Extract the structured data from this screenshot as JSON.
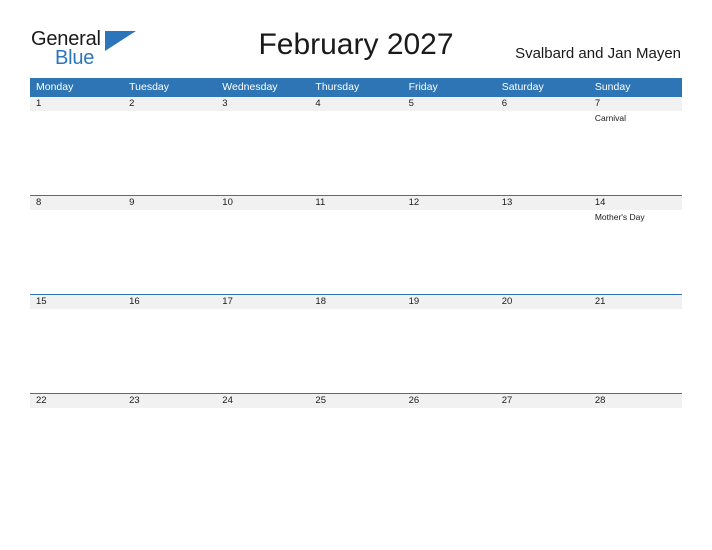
{
  "brand": {
    "name_part1": "General",
    "name_part2": "Blue",
    "triangle_icon": "triangle-icon",
    "color_dark": "#1a1a1a",
    "color_blue": "#2b76bb"
  },
  "header": {
    "month_title": "February 2027",
    "locale": "Svalbard and Jan Mayen"
  },
  "calendar": {
    "header_color": "#2e75b6",
    "band_color": "#f1f1f1",
    "weekdays": [
      "Monday",
      "Tuesday",
      "Wednesday",
      "Thursday",
      "Friday",
      "Saturday",
      "Sunday"
    ],
    "weeks": [
      [
        {
          "day": "1",
          "events": []
        },
        {
          "day": "2",
          "events": []
        },
        {
          "day": "3",
          "events": []
        },
        {
          "day": "4",
          "events": []
        },
        {
          "day": "5",
          "events": []
        },
        {
          "day": "6",
          "events": []
        },
        {
          "day": "7",
          "events": [
            "Carnival"
          ]
        }
      ],
      [
        {
          "day": "8",
          "events": []
        },
        {
          "day": "9",
          "events": []
        },
        {
          "day": "10",
          "events": []
        },
        {
          "day": "11",
          "events": []
        },
        {
          "day": "12",
          "events": []
        },
        {
          "day": "13",
          "events": []
        },
        {
          "day": "14",
          "events": [
            "Mother's Day"
          ]
        }
      ],
      [
        {
          "day": "15",
          "events": []
        },
        {
          "day": "16",
          "events": []
        },
        {
          "day": "17",
          "events": []
        },
        {
          "day": "18",
          "events": []
        },
        {
          "day": "19",
          "events": []
        },
        {
          "day": "20",
          "events": []
        },
        {
          "day": "21",
          "events": []
        }
      ],
      [
        {
          "day": "22",
          "events": []
        },
        {
          "day": "23",
          "events": []
        },
        {
          "day": "24",
          "events": []
        },
        {
          "day": "25",
          "events": []
        },
        {
          "day": "26",
          "events": []
        },
        {
          "day": "27",
          "events": []
        },
        {
          "day": "28",
          "events": []
        }
      ]
    ]
  }
}
